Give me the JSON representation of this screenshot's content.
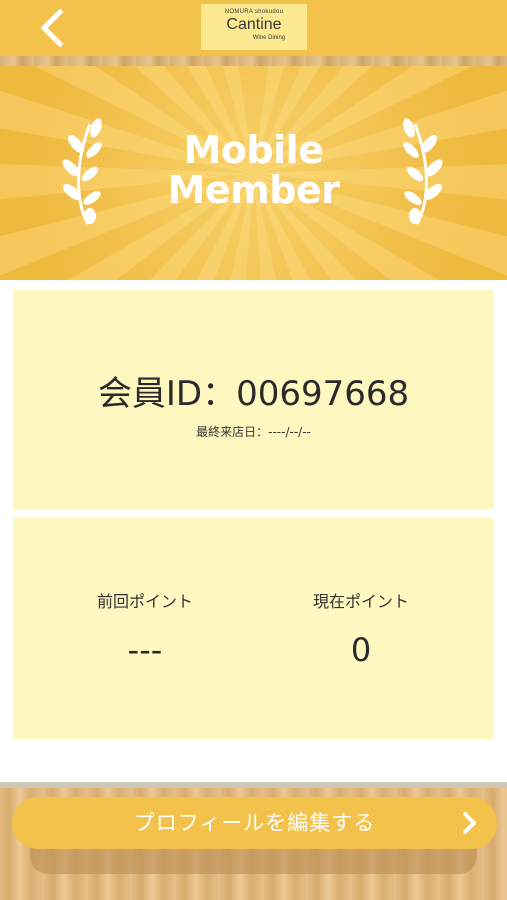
{
  "header": {
    "back_icon": "chevron-left-icon",
    "logo": {
      "top_text": "NOMURA shokudou",
      "main_text": "Cantine",
      "sub_text": "Wine Dining"
    }
  },
  "hero": {
    "title_line1": "Mobile",
    "title_line2": "Member",
    "left_icon": "laurel-branch-icon",
    "right_icon": "laurel-branch-icon"
  },
  "member": {
    "id_text": "会員ID：00697668",
    "last_visit_text": "最終来店日：----/--/--"
  },
  "points": {
    "previous_label": "前回ポイント",
    "previous_value": "---",
    "current_label": "現在ポイント",
    "current_value": "0"
  },
  "footer": {
    "edit_profile_label": "プロフィールを編集する",
    "edit_icon": "chevron-right-icon"
  },
  "colors": {
    "accent": "#f2c24a",
    "card_bg": "#fff7c0",
    "text": "#2a2a2a"
  }
}
